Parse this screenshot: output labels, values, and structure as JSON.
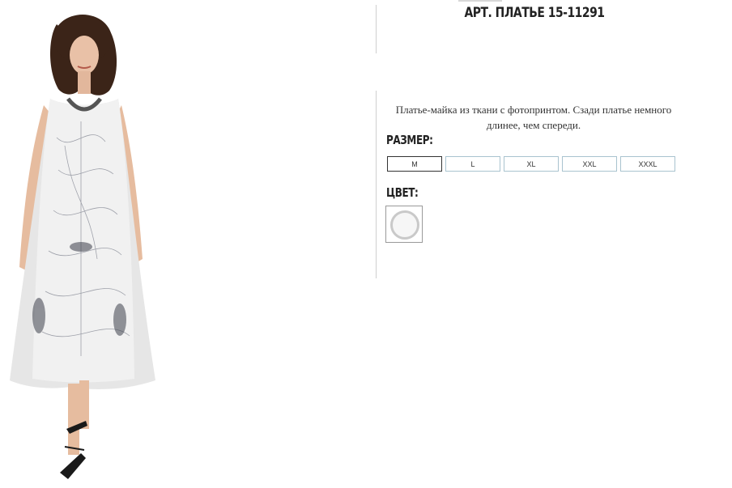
{
  "product": {
    "title": "АРТ. ПЛАТЬЕ 15-11291",
    "description": "Платье-майка из ткани с фотопринтом. Сзади платье немного длинее, чем спереди."
  },
  "size": {
    "label": "РАЗМЕР:",
    "options": [
      "M",
      "L",
      "XL",
      "XXL",
      "XXXL"
    ],
    "selected": "M"
  },
  "color": {
    "label": "ЦВЕТ:",
    "swatch_color": "#f6f6f6"
  },
  "colors": {
    "selected_border": "#333333",
    "option_border": "#a9c3cf"
  }
}
